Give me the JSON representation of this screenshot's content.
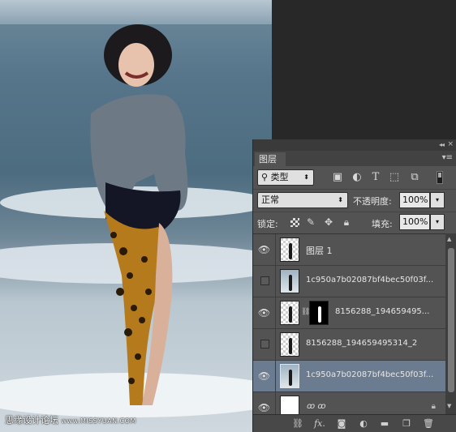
{
  "watermark": {
    "cn": "思缘设计论坛",
    "url": "www.MISSYUAN.COM"
  },
  "panel": {
    "tab_label": "图层",
    "collapse_icon": "double-chevron-icon",
    "close_icon": "close-icon",
    "menu_icon": "panel-menu-icon",
    "filter": {
      "label": "类型",
      "icons": [
        "image-filter-icon",
        "adjustment-filter-icon",
        "type-filter-icon",
        "shape-filter-icon",
        "smart-object-filter-icon"
      ]
    },
    "blend_mode": "正常",
    "opacity_label": "不透明度:",
    "opacity_value": "100%",
    "lock_label": "锁定:",
    "lock_icons": [
      "lock-transparent-icon",
      "lock-pixels-icon",
      "lock-position-icon",
      "lock-all-icon"
    ],
    "fill_label": "填充:",
    "fill_value": "100%",
    "layers": [
      {
        "name": "图层 1",
        "visible": true,
        "selected": false
      },
      {
        "name": "1c950a7b02087bf4bec50f03f...",
        "visible": false,
        "selected": false
      },
      {
        "name": "8156288_194659495...",
        "visible": true,
        "selected": false,
        "has_mask": true
      },
      {
        "name": "8156288_194659495314_2",
        "visible": false,
        "selected": false
      },
      {
        "name": "1c950a7b02087bf4bec50f03f...",
        "visible": true,
        "selected": true
      },
      {
        "name": "",
        "visible": true,
        "selected": false,
        "locked": true
      }
    ],
    "bottom_icons": [
      "link-layers-icon",
      "fx-icon",
      "add-mask-icon",
      "adjustment-layer-icon",
      "new-group-icon",
      "new-layer-icon",
      "trash-icon"
    ],
    "fx_text": "fx."
  }
}
